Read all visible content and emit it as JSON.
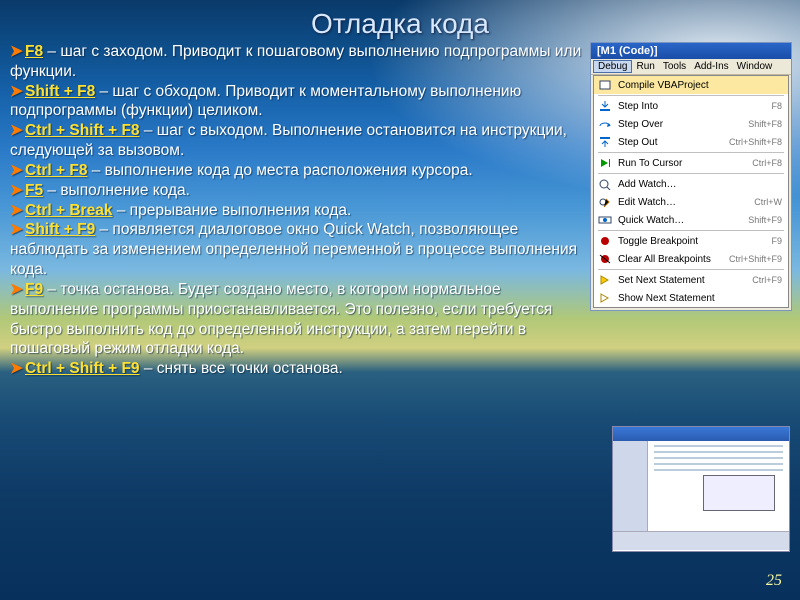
{
  "title": "Отладка кода",
  "page_number": "25",
  "bullets": [
    {
      "key": "F8",
      "text": " – шаг с заходом. Приводит к пошаговому выполнению подпрограммы или функции."
    },
    {
      "key": "Shift + F8",
      "text": " – шаг с обходом. Приводит к моментальному выполнению подпрограммы (функции) целиком."
    },
    {
      "key": "Ctrl + Shift + F8",
      "text": " – шаг с выходом. Выполнение остановится на инструкции, следующей за вызовом."
    },
    {
      "key": "Ctrl + F8",
      "text": " – выполнение кода до места расположения курсора."
    },
    {
      "key": "F5",
      "text": " – выполнение кода."
    },
    {
      "key": "Ctrl + Break",
      "text": " – прерывание выполнения кода."
    },
    {
      "key": "Shift + F9",
      "text": " – появляется диалоговое окно Quick Watch, позволяющее наблюдать за изменением определенной переменной в процессе выполнения кода."
    },
    {
      "key": "F9",
      "text": " – точка останова. Будет создано место, в котором нормальное выполнение программы приостанавливается. Это полезно, если требуется быстро выполнить код до определенной инструкции, а затем перейти в пошаговый режим отладки кода."
    },
    {
      "key": "Ctrl + Shift + F9",
      "text": " – снять все точки останова."
    }
  ],
  "panel": {
    "window_title": "[M1 (Code)]",
    "menus": [
      "Debug",
      "Run",
      "Tools",
      "Add-Ins",
      "Window"
    ],
    "open_index": 0,
    "items": [
      {
        "icon": "compile",
        "label": "Compile VBAProject",
        "shortcut": "",
        "hl": true
      },
      {
        "sep": true
      },
      {
        "icon": "step-into",
        "label": "Step Into",
        "shortcut": "F8"
      },
      {
        "icon": "step-over",
        "label": "Step Over",
        "shortcut": "Shift+F8"
      },
      {
        "icon": "step-out",
        "label": "Step Out",
        "shortcut": "Ctrl+Shift+F8"
      },
      {
        "sep": true
      },
      {
        "icon": "run-to",
        "label": "Run To Cursor",
        "shortcut": "Ctrl+F8"
      },
      {
        "sep": true
      },
      {
        "icon": "add-watch",
        "label": "Add Watch…",
        "shortcut": ""
      },
      {
        "icon": "edit-watch",
        "label": "Edit Watch…",
        "shortcut": "Ctrl+W"
      },
      {
        "icon": "quick-watch",
        "label": "Quick Watch…",
        "shortcut": "Shift+F9"
      },
      {
        "sep": true
      },
      {
        "icon": "breakpoint",
        "label": "Toggle Breakpoint",
        "shortcut": "F9"
      },
      {
        "icon": "clear-bp",
        "label": "Clear All Breakpoints",
        "shortcut": "Ctrl+Shift+F9"
      },
      {
        "sep": true
      },
      {
        "icon": "set-next",
        "label": "Set Next Statement",
        "shortcut": "Ctrl+F9"
      },
      {
        "icon": "show-next",
        "label": "Show Next Statement",
        "shortcut": ""
      }
    ]
  }
}
